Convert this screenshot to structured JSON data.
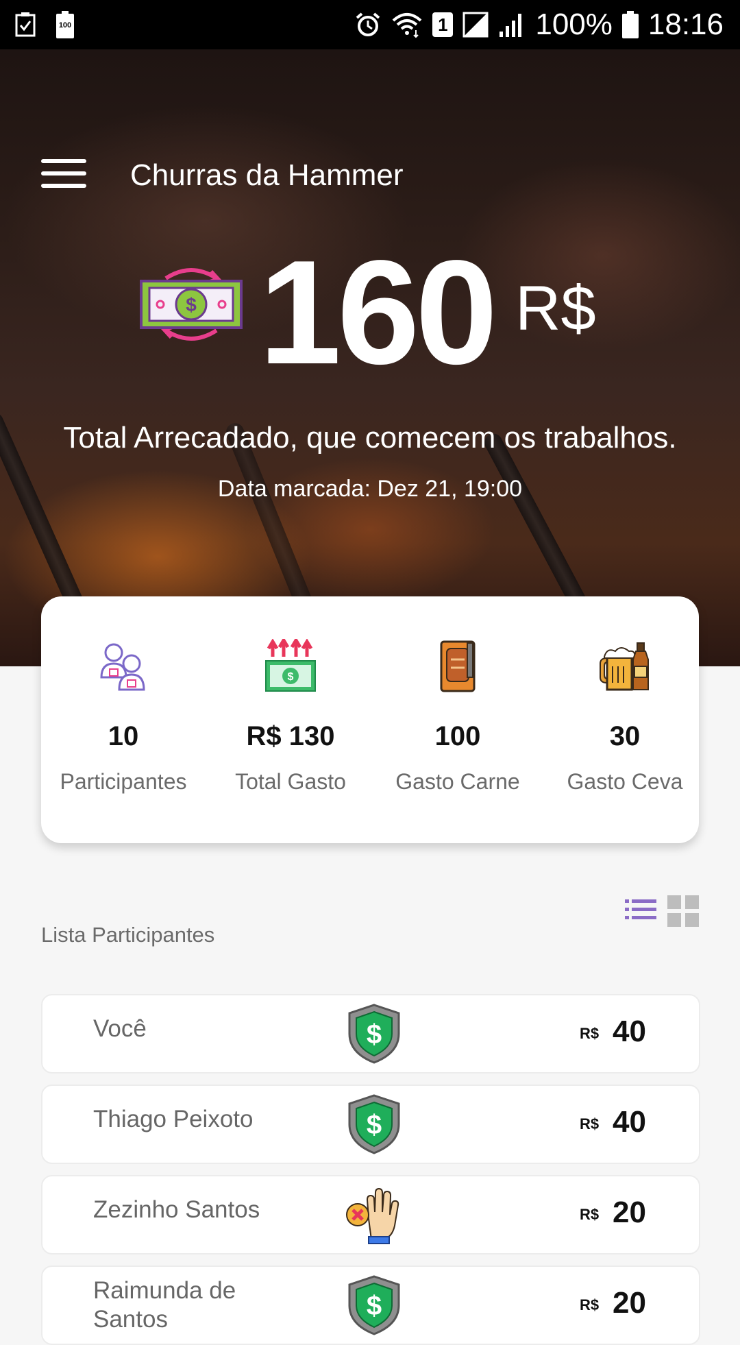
{
  "status_bar": {
    "battery_small": "100",
    "sim_slot": "1",
    "battery_percent": "100%",
    "time": "18:16"
  },
  "header": {
    "menu_icon": "hamburger-menu-icon",
    "title": "Churras da Hammer"
  },
  "summary": {
    "icon": "money-exchange-icon",
    "total": "160",
    "currency": "R$",
    "subtitle": "Total Arrecadado, que comecem os trabalhos.",
    "date": "Data marcada: Dez 21, 19:00"
  },
  "stats": [
    {
      "value": "10",
      "label": "Participantes",
      "icon": "participants-icon"
    },
    {
      "value": "R$ 130",
      "label": "Total Gasto",
      "icon": "money-spent-icon"
    },
    {
      "value": "100",
      "label": "Gasto Carne",
      "icon": "meat-cutting-board-icon"
    },
    {
      "value": "30",
      "label": "Gasto Ceva",
      "icon": "beer-icon"
    }
  ],
  "list": {
    "title": "Lista Participantes",
    "view_list_icon": "list-view-icon",
    "view_grid_icon": "grid-view-icon",
    "active_color": "#8b6cc6",
    "inactive_color": "#bdbdbd"
  },
  "participants": [
    {
      "name": "Você",
      "status": "paid",
      "status_icon": "paid-shield-icon",
      "currency": "R$",
      "amount": "40"
    },
    {
      "name": "Thiago Peixoto",
      "status": "paid",
      "status_icon": "paid-shield-icon",
      "currency": "R$",
      "amount": "40"
    },
    {
      "name": "Zezinho Santos",
      "status": "not-paid",
      "status_icon": "not-paid-hand-icon",
      "currency": "R$",
      "amount": "20"
    },
    {
      "name": "Raimunda de Santos",
      "status": "paid",
      "status_icon": "paid-shield-icon",
      "currency": "R$",
      "amount": "20"
    }
  ],
  "colors": {
    "shield_green": "#1fae5a",
    "shield_gray": "#8f8f8f",
    "money_pink": "#e83e8c"
  }
}
